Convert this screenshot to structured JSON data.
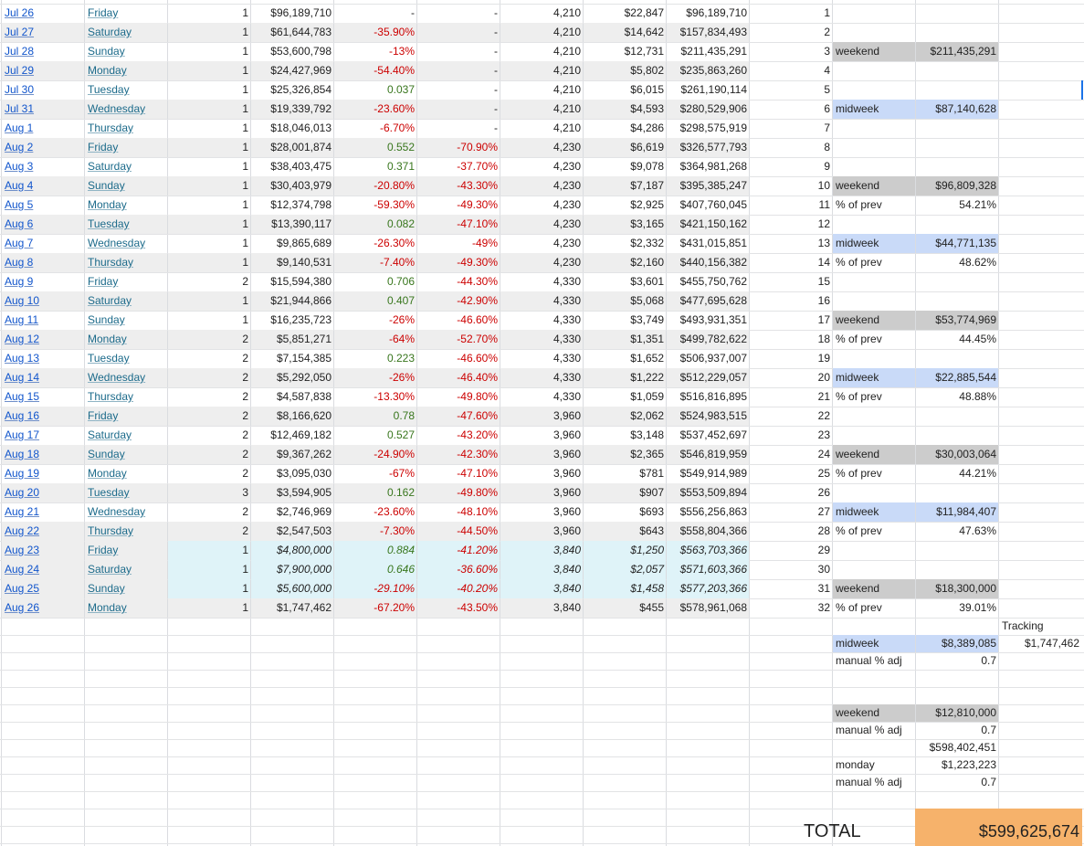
{
  "rows": [
    {
      "date": "Jul 26",
      "day": "Friday",
      "n": "1",
      "gross": "$96,189,710",
      "pct_prev": "-",
      "pct_week": "-",
      "theaters": "4,210",
      "avg": "$22,847",
      "total": "$96,189,710",
      "dnum": "1",
      "bg": "white",
      "pct_prev_color": "plain",
      "pct_week_color": "plain",
      "italic": false
    },
    {
      "date": "Jul 27",
      "day": "Saturday",
      "n": "1",
      "gross": "$61,644,783",
      "pct_prev": "-35.90%",
      "pct_week": "-",
      "theaters": "4,210",
      "avg": "$14,642",
      "total": "$157,834,493",
      "dnum": "2",
      "bg": "grey",
      "pct_prev_color": "neg",
      "pct_week_color": "plain",
      "italic": false
    },
    {
      "date": "Jul 28",
      "day": "Sunday",
      "n": "1",
      "gross": "$53,600,798",
      "pct_prev": "-13%",
      "pct_week": "-",
      "theaters": "4,210",
      "avg": "$12,731",
      "total": "$211,435,291",
      "dnum": "3",
      "bg": "white",
      "pct_prev_color": "neg",
      "pct_week_color": "plain",
      "italic": false
    },
    {
      "date": "Jul 29",
      "day": "Monday",
      "n": "1",
      "gross": "$24,427,969",
      "pct_prev": "-54.40%",
      "pct_week": "-",
      "theaters": "4,210",
      "avg": "$5,802",
      "total": "$235,863,260",
      "dnum": "4",
      "bg": "grey",
      "pct_prev_color": "neg",
      "pct_week_color": "plain",
      "italic": false
    },
    {
      "date": "Jul 30",
      "day": "Tuesday",
      "n": "1",
      "gross": "$25,326,854",
      "pct_prev": "0.037",
      "pct_week": "-",
      "theaters": "4,210",
      "avg": "$6,015",
      "total": "$261,190,114",
      "dnum": "5",
      "bg": "white",
      "pct_prev_color": "pos",
      "pct_week_color": "plain",
      "italic": false
    },
    {
      "date": "Jul 31",
      "day": "Wednesday",
      "n": "1",
      "gross": "$19,339,792",
      "pct_prev": "-23.60%",
      "pct_week": "-",
      "theaters": "4,210",
      "avg": "$4,593",
      "total": "$280,529,906",
      "dnum": "6",
      "bg": "grey",
      "pct_prev_color": "neg",
      "pct_week_color": "plain",
      "italic": false
    },
    {
      "date": "Aug 1",
      "day": "Thursday",
      "n": "1",
      "gross": "$18,046,013",
      "pct_prev": "-6.70%",
      "pct_week": "-",
      "theaters": "4,210",
      "avg": "$4,286",
      "total": "$298,575,919",
      "dnum": "7",
      "bg": "white",
      "pct_prev_color": "neg",
      "pct_week_color": "plain",
      "italic": false
    },
    {
      "date": "Aug 2",
      "day": "Friday",
      "n": "1",
      "gross": "$28,001,874",
      "pct_prev": "0.552",
      "pct_week": "-70.90%",
      "theaters": "4,230",
      "avg": "$6,619",
      "total": "$326,577,793",
      "dnum": "8",
      "bg": "grey",
      "pct_prev_color": "pos",
      "pct_week_color": "neg",
      "italic": false
    },
    {
      "date": "Aug 3",
      "day": "Saturday",
      "n": "1",
      "gross": "$38,403,475",
      "pct_prev": "0.371",
      "pct_week": "-37.70%",
      "theaters": "4,230",
      "avg": "$9,078",
      "total": "$364,981,268",
      "dnum": "9",
      "bg": "white",
      "pct_prev_color": "pos",
      "pct_week_color": "neg",
      "italic": false
    },
    {
      "date": "Aug 4",
      "day": "Sunday",
      "n": "1",
      "gross": "$30,403,979",
      "pct_prev": "-20.80%",
      "pct_week": "-43.30%",
      "theaters": "4,230",
      "avg": "$7,187",
      "total": "$395,385,247",
      "dnum": "10",
      "bg": "grey",
      "pct_prev_color": "neg",
      "pct_week_color": "neg",
      "italic": false
    },
    {
      "date": "Aug 5",
      "day": "Monday",
      "n": "1",
      "gross": "$12,374,798",
      "pct_prev": "-59.30%",
      "pct_week": "-49.30%",
      "theaters": "4,230",
      "avg": "$2,925",
      "total": "$407,760,045",
      "dnum": "11",
      "bg": "white",
      "pct_prev_color": "neg",
      "pct_week_color": "neg",
      "italic": false
    },
    {
      "date": "Aug 6",
      "day": "Tuesday",
      "n": "1",
      "gross": "$13,390,117",
      "pct_prev": "0.082",
      "pct_week": "-47.10%",
      "theaters": "4,230",
      "avg": "$3,165",
      "total": "$421,150,162",
      "dnum": "12",
      "bg": "grey",
      "pct_prev_color": "pos",
      "pct_week_color": "neg",
      "italic": false
    },
    {
      "date": "Aug 7",
      "day": "Wednesday",
      "n": "1",
      "gross": "$9,865,689",
      "pct_prev": "-26.30%",
      "pct_week": "-49%",
      "theaters": "4,230",
      "avg": "$2,332",
      "total": "$431,015,851",
      "dnum": "13",
      "bg": "white",
      "pct_prev_color": "neg",
      "pct_week_color": "neg",
      "italic": false
    },
    {
      "date": "Aug 8",
      "day": "Thursday",
      "n": "1",
      "gross": "$9,140,531",
      "pct_prev": "-7.40%",
      "pct_week": "-49.30%",
      "theaters": "4,230",
      "avg": "$2,160",
      "total": "$440,156,382",
      "dnum": "14",
      "bg": "grey",
      "pct_prev_color": "neg",
      "pct_week_color": "neg",
      "italic": false
    },
    {
      "date": "Aug 9",
      "day": "Friday",
      "n": "2",
      "gross": "$15,594,380",
      "pct_prev": "0.706",
      "pct_week": "-44.30%",
      "theaters": "4,330",
      "avg": "$3,601",
      "total": "$455,750,762",
      "dnum": "15",
      "bg": "white",
      "pct_prev_color": "pos",
      "pct_week_color": "neg",
      "italic": false
    },
    {
      "date": "Aug 10",
      "day": "Saturday",
      "n": "1",
      "gross": "$21,944,866",
      "pct_prev": "0.407",
      "pct_week": "-42.90%",
      "theaters": "4,330",
      "avg": "$5,068",
      "total": "$477,695,628",
      "dnum": "16",
      "bg": "grey",
      "pct_prev_color": "pos",
      "pct_week_color": "neg",
      "italic": false
    },
    {
      "date": "Aug 11",
      "day": "Sunday",
      "n": "1",
      "gross": "$16,235,723",
      "pct_prev": "-26%",
      "pct_week": "-46.60%",
      "theaters": "4,330",
      "avg": "$3,749",
      "total": "$493,931,351",
      "dnum": "17",
      "bg": "white",
      "pct_prev_color": "neg",
      "pct_week_color": "neg",
      "italic": false
    },
    {
      "date": "Aug 12",
      "day": "Monday",
      "n": "2",
      "gross": "$5,851,271",
      "pct_prev": "-64%",
      "pct_week": "-52.70%",
      "theaters": "4,330",
      "avg": "$1,351",
      "total": "$499,782,622",
      "dnum": "18",
      "bg": "grey",
      "pct_prev_color": "neg",
      "pct_week_color": "neg",
      "italic": false
    },
    {
      "date": "Aug 13",
      "day": "Tuesday",
      "n": "2",
      "gross": "$7,154,385",
      "pct_prev": "0.223",
      "pct_week": "-46.60%",
      "theaters": "4,330",
      "avg": "$1,652",
      "total": "$506,937,007",
      "dnum": "19",
      "bg": "white",
      "pct_prev_color": "pos",
      "pct_week_color": "neg",
      "italic": false
    },
    {
      "date": "Aug 14",
      "day": "Wednesday",
      "n": "2",
      "gross": "$5,292,050",
      "pct_prev": "-26%",
      "pct_week": "-46.40%",
      "theaters": "4,330",
      "avg": "$1,222",
      "total": "$512,229,057",
      "dnum": "20",
      "bg": "grey",
      "pct_prev_color": "neg",
      "pct_week_color": "neg",
      "italic": false
    },
    {
      "date": "Aug 15",
      "day": "Thursday",
      "n": "2",
      "gross": "$4,587,838",
      "pct_prev": "-13.30%",
      "pct_week": "-49.80%",
      "theaters": "4,330",
      "avg": "$1,059",
      "total": "$516,816,895",
      "dnum": "21",
      "bg": "white",
      "pct_prev_color": "neg",
      "pct_week_color": "neg",
      "italic": false
    },
    {
      "date": "Aug 16",
      "day": "Friday",
      "n": "2",
      "gross": "$8,166,620",
      "pct_prev": "0.78",
      "pct_week": "-47.60%",
      "theaters": "3,960",
      "avg": "$2,062",
      "total": "$524,983,515",
      "dnum": "22",
      "bg": "grey",
      "pct_prev_color": "pos",
      "pct_week_color": "neg",
      "italic": false
    },
    {
      "date": "Aug 17",
      "day": "Saturday",
      "n": "2",
      "gross": "$12,469,182",
      "pct_prev": "0.527",
      "pct_week": "-43.20%",
      "theaters": "3,960",
      "avg": "$3,148",
      "total": "$537,452,697",
      "dnum": "23",
      "bg": "white",
      "pct_prev_color": "pos",
      "pct_week_color": "neg",
      "italic": false
    },
    {
      "date": "Aug 18",
      "day": "Sunday",
      "n": "2",
      "gross": "$9,367,262",
      "pct_prev": "-24.90%",
      "pct_week": "-42.30%",
      "theaters": "3,960",
      "avg": "$2,365",
      "total": "$546,819,959",
      "dnum": "24",
      "bg": "grey",
      "pct_prev_color": "neg",
      "pct_week_color": "neg",
      "italic": false
    },
    {
      "date": "Aug 19",
      "day": "Monday",
      "n": "2",
      "gross": "$3,095,030",
      "pct_prev": "-67%",
      "pct_week": "-47.10%",
      "theaters": "3,960",
      "avg": "$781",
      "total": "$549,914,989",
      "dnum": "25",
      "bg": "white",
      "pct_prev_color": "neg",
      "pct_week_color": "neg",
      "italic": false
    },
    {
      "date": "Aug 20",
      "day": "Tuesday",
      "n": "3",
      "gross": "$3,594,905",
      "pct_prev": "0.162",
      "pct_week": "-49.80%",
      "theaters": "3,960",
      "avg": "$907",
      "total": "$553,509,894",
      "dnum": "26",
      "bg": "grey",
      "pct_prev_color": "pos",
      "pct_week_color": "neg",
      "italic": false
    },
    {
      "date": "Aug 21",
      "day": "Wednesday",
      "n": "2",
      "gross": "$2,746,969",
      "pct_prev": "-23.60%",
      "pct_week": "-48.10%",
      "theaters": "3,960",
      "avg": "$693",
      "total": "$556,256,863",
      "dnum": "27",
      "bg": "white",
      "pct_prev_color": "neg",
      "pct_week_color": "neg",
      "italic": false
    },
    {
      "date": "Aug 22",
      "day": "Thursday",
      "n": "2",
      "gross": "$2,547,503",
      "pct_prev": "-7.30%",
      "pct_week": "-44.50%",
      "theaters": "3,960",
      "avg": "$643",
      "total": "$558,804,366",
      "dnum": "28",
      "bg": "grey",
      "pct_prev_color": "neg",
      "pct_week_color": "neg",
      "italic": false
    },
    {
      "date": "Aug 23",
      "day": "Friday",
      "n": "1",
      "gross": "$4,800,000",
      "pct_prev": "0.884",
      "pct_week": "-41.20%",
      "theaters": "3,840",
      "avg": "$1,250",
      "total": "$563,703,366",
      "dnum": "29",
      "bg": "blue",
      "pct_prev_color": "pos",
      "pct_week_color": "neg",
      "italic": true
    },
    {
      "date": "Aug 24",
      "day": "Saturday",
      "n": "1",
      "gross": "$7,900,000",
      "pct_prev": "0.646",
      "pct_week": "-36.60%",
      "theaters": "3,840",
      "avg": "$2,057",
      "total": "$571,603,366",
      "dnum": "30",
      "bg": "blue",
      "pct_prev_color": "pos",
      "pct_week_color": "neg",
      "italic": true
    },
    {
      "date": "Aug 25",
      "day": "Sunday",
      "n": "1",
      "gross": "$5,600,000",
      "pct_prev": "-29.10%",
      "pct_week": "-40.20%",
      "theaters": "3,840",
      "avg": "$1,458",
      "total": "$577,203,366",
      "dnum": "31",
      "bg": "blue",
      "pct_prev_color": "neg",
      "pct_week_color": "neg",
      "italic": true
    },
    {
      "date": "Aug 26",
      "day": "Monday",
      "n": "1",
      "gross": "$1,747,462",
      "pct_prev": "-67.20%",
      "pct_week": "-43.50%",
      "theaters": "3,840",
      "avg": "$455",
      "total": "$578,961,068",
      "dnum": "32",
      "bg": "grey",
      "pct_prev_color": "neg",
      "pct_week_color": "neg",
      "italic": false
    }
  ],
  "side": [
    {
      "row": 2,
      "label": "weekend",
      "value": "$211,435,291",
      "kind": "weekend"
    },
    {
      "row": 5,
      "label": "midweek",
      "value": "$87,140,628",
      "kind": "midweek"
    },
    {
      "row": 9,
      "label": "weekend",
      "value": "$96,809,328",
      "kind": "weekend"
    },
    {
      "row": 10,
      "label": "% of prev",
      "value": "54.21%",
      "kind": "plain"
    },
    {
      "row": 12,
      "label": "midweek",
      "value": "$44,771,135",
      "kind": "midweek"
    },
    {
      "row": 13,
      "label": "% of prev",
      "value": "48.62%",
      "kind": "plain"
    },
    {
      "row": 16,
      "label": "weekend",
      "value": "$53,774,969",
      "kind": "weekend"
    },
    {
      "row": 17,
      "label": "% of prev",
      "value": "44.45%",
      "kind": "plain"
    },
    {
      "row": 19,
      "label": "midweek",
      "value": "$22,885,544",
      "kind": "midweek"
    },
    {
      "row": 20,
      "label": "% of prev",
      "value": "48.88%",
      "kind": "plain"
    },
    {
      "row": 23,
      "label": "weekend",
      "value": "$30,003,064",
      "kind": "weekend"
    },
    {
      "row": 24,
      "label": "% of prev",
      "value": "44.21%",
      "kind": "plain"
    },
    {
      "row": 26,
      "label": "midweek",
      "value": "$11,984,407",
      "kind": "midweek"
    },
    {
      "row": 27,
      "label": "% of prev",
      "value": "47.63%",
      "kind": "plain"
    },
    {
      "row": 30,
      "label": "weekend",
      "value": "$18,300,000",
      "kind": "weekend"
    },
    {
      "row": 31,
      "label": "% of prev",
      "value": "39.01%",
      "kind": "plain"
    }
  ],
  "extra": {
    "tracking_label": "Tracking",
    "tracking_value": "$1,747,462",
    "midweek_label": "midweek",
    "midweek_value": "$8,389,085",
    "adj1_label": "manual % adj",
    "adj1_value": "0.7",
    "weekend_label": "weekend",
    "weekend_value": "$12,810,000",
    "adj2_label": "manual % adj",
    "adj2_value": "0.7",
    "subtotal_value": "$598,402,451",
    "monday_label": "monday",
    "monday_value": "$1,223,223",
    "adj3_label": "manual % adj",
    "adj3_value": "0.7",
    "total_label": "TOTAL",
    "total_value": "$599,625,674"
  },
  "colors": {
    "link": "#1155cc",
    "negative": "#cc0000",
    "positive": "#38761d",
    "weekend_label_bg": "#cccccc",
    "midweek_label_bg": "#c9daf8",
    "forecast_row_bg": "#dff3f8",
    "total_bg": "#f6b26b"
  }
}
